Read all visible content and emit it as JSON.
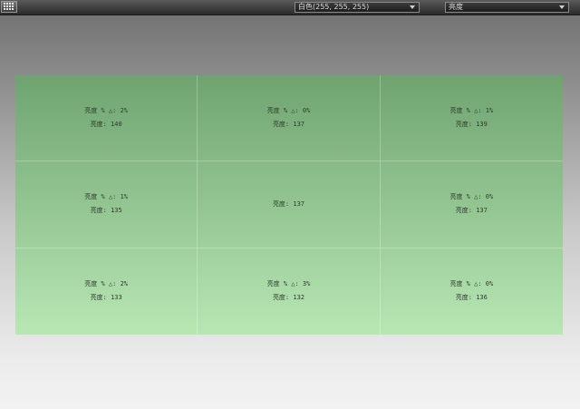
{
  "toolbar": {
    "color_dropdown": {
      "value": "白色(255, 255, 255)"
    },
    "mode_dropdown": {
      "value": "亮度"
    }
  },
  "grid": {
    "cells": [
      {
        "delta_label": "亮度 % △:",
        "delta_value": "2%",
        "brightness_label": "亮度:",
        "brightness_value": "140"
      },
      {
        "delta_label": "亮度 % △:",
        "delta_value": "0%",
        "brightness_label": "亮度:",
        "brightness_value": "137"
      },
      {
        "delta_label": "亮度 % △:",
        "delta_value": "1%",
        "brightness_label": "亮度:",
        "brightness_value": "139"
      },
      {
        "delta_label": "亮度 % △:",
        "delta_value": "1%",
        "brightness_label": "亮度:",
        "brightness_value": "135"
      },
      {
        "delta_label": "",
        "delta_value": "",
        "brightness_label": "亮度:",
        "brightness_value": "137"
      },
      {
        "delta_label": "亮度 % △:",
        "delta_value": "0%",
        "brightness_label": "亮度:",
        "brightness_value": "137"
      },
      {
        "delta_label": "亮度 % △:",
        "delta_value": "2%",
        "brightness_label": "亮度:",
        "brightness_value": "133"
      },
      {
        "delta_label": "亮度 % △:",
        "delta_value": "3%",
        "brightness_label": "亮度:",
        "brightness_value": "132"
      },
      {
        "delta_label": "亮度 % △:",
        "delta_value": "0%",
        "brightness_label": "亮度:",
        "brightness_value": "136"
      }
    ]
  }
}
